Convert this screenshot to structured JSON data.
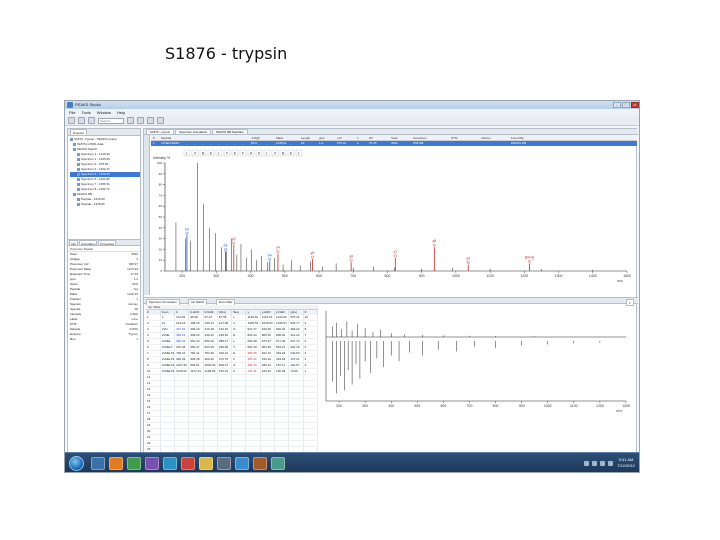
{
  "slide": {
    "title": "S1876 - trypsin"
  },
  "window": {
    "title": "PEAKS Studio",
    "menu": [
      "File",
      "Tools",
      "Window",
      "Help"
    ],
    "search_placeholder": "Search..."
  },
  "project_tree": {
    "items": [
      "S1876 - trypsin - PEAKS project",
      "S1876 mzXML data",
      "PEAKS Search",
      "Spectrum 1 - 1216.93",
      "Spectrum 2 - 1345.66",
      "Spectrum 3 - 978.52",
      "Spectrum 4 - 1102.47",
      "Spectrum 5 - 1376.23",
      "Spectrum 6 - 1421.80",
      "Spectrum 7 - 1056.31",
      "Spectrum 8 - 1190.72",
      "PEAKS DB",
      "Peptide - 1216.93",
      "Peptide - 1345.66"
    ],
    "selected_index": 7
  },
  "properties": {
    "tabs": [
      "Info",
      "Annotation",
      "Properties"
    ],
    "header": "Precursor Details",
    "rows": [
      [
        "Scan",
        "3520"
      ],
      [
        "Charge",
        "2"
      ],
      [
        "Precursor m/z",
        "608.97"
      ],
      [
        "Precursor Mass",
        "1215.93"
      ],
      [
        "Retention Time",
        "37.45"
      ],
      [
        "ppm",
        "1.2"
      ],
      [
        "Score",
        "56.8"
      ],
      [
        "Peptide",
        "Yes"
      ],
      [
        "Mass",
        "1216.93"
      ],
      [
        "Fraction",
        "1"
      ],
      [
        "Species",
        "Human"
      ],
      [
        "Spectra",
        "38"
      ],
      [
        "Intensity",
        "2.5E6"
      ],
      [
        "Label",
        "none"
      ],
      [
        "PTM",
        "Oxidation"
      ],
      [
        "Sample",
        "S1876"
      ],
      [
        "Enzyme",
        "Trypsin"
      ],
      [
        "Run",
        "1"
      ]
    ]
  },
  "doc_tabs": [
    "S1876 - trypsin",
    "Spectrum Annotation",
    "PEAKS DB Peptides"
  ],
  "psm_table": {
    "headers": [
      "#",
      "Peptide",
      "-10lgP",
      "Mass",
      "Length",
      "ppm",
      "m/z",
      "z",
      "RT",
      "Scan",
      "Accession",
      "PTM",
      "AScore",
      "Found By"
    ],
    "row": [
      "1",
      "LVNELTEFAK",
      "56.8",
      "1148.61",
      "10",
      "1.2",
      "575.31",
      "2",
      "37.45",
      "3520",
      "P02768",
      "",
      "",
      "PEAKS DB"
    ]
  },
  "lower_tabs": [
    "Spectrum Annotation",
    "Ion Match",
    "Error Map"
  ],
  "frag_table": {
    "tab": "Ion Table",
    "headers": [
      "#",
      "b-ion",
      "b",
      "b-H2O",
      "b-NH3",
      "b(2+)",
      "Seq",
      "y",
      "y-H2O",
      "y-NH3",
      "y(2+)",
      "#"
    ],
    "rows": [
      [
        "1",
        "L",
        "114.09",
        "96.08",
        "97.07",
        "57.55",
        "L",
        "1149.62",
        "1131.61",
        "1132.60",
        "575.31",
        "10"
      ],
      [
        "2",
        "LV",
        "213.16",
        "195.15",
        "196.13",
        "107.08",
        "V",
        "1036.54",
        "1018.53",
        "1019.51",
        "518.77",
        "9"
      ],
      [
        "3",
        "LVN",
        "327.20",
        "309.19",
        "310.18",
        "164.10",
        "N",
        "937.47",
        "919.46",
        "920.44",
        "469.24",
        "8"
      ],
      [
        "4",
        "LVNE",
        "456.24",
        "438.23",
        "439.22",
        "228.62",
        "E",
        "823.43",
        "805.42",
        "806.40",
        "412.22",
        "7"
      ],
      [
        "5",
        "LVNEL",
        "569.33",
        "551.32",
        "552.30",
        "285.17",
        "L",
        "694.38",
        "676.37",
        "677.36",
        "347.70",
        "6"
      ],
      [
        "6",
        "LVNELT",
        "670.38",
        "652.37",
        "653.35",
        "335.69",
        "T",
        "581.30",
        "563.29",
        "564.27",
        "291.15",
        "5"
      ],
      [
        "7",
        "LVNELTE",
        "799.42",
        "781.41",
        "782.39",
        "400.21",
        "E",
        "480.25",
        "462.24",
        "463.22",
        "240.63",
        "4"
      ],
      [
        "8",
        "LVNELTEF",
        "946.49",
        "928.48",
        "929.46",
        "473.75",
        "F",
        "351.21",
        "333.20",
        "334.18",
        "176.11",
        "3"
      ],
      [
        "9",
        "LVNELTEFA",
        "1017.52",
        "999.51",
        "1000.50",
        "509.27",
        "A",
        "204.13",
        "186.12",
        "187.11",
        "102.57",
        "2"
      ],
      [
        "10",
        "LVNELTEFAK",
        "1145.62",
        "1127.61",
        "1128.59",
        "573.31",
        "K",
        "147.11",
        "129.10",
        "130.09",
        "74.06",
        "1"
      ],
      [
        "11",
        "",
        "",
        "",
        "",
        "",
        "",
        "",
        "",
        "",
        "",
        ""
      ],
      [
        "12",
        "",
        "",
        "",
        "",
        "",
        "",
        "",
        "",
        "",
        "",
        ""
      ],
      [
        "13",
        "",
        "",
        "",
        "",
        "",
        "",
        "",
        "",
        "",
        "",
        ""
      ],
      [
        "14",
        "",
        "",
        "",
        "",
        "",
        "",
        "",
        "",
        "",
        "",
        ""
      ],
      [
        "15",
        "",
        "",
        "",
        "",
        "",
        "",
        "",
        "",
        "",
        "",
        ""
      ],
      [
        "16",
        "",
        "",
        "",
        "",
        "",
        "",
        "",
        "",
        "",
        "",
        ""
      ],
      [
        "17",
        "",
        "",
        "",
        "",
        "",
        "",
        "",
        "",
        "",
        "",
        ""
      ],
      [
        "18",
        "",
        "",
        "",
        "",
        "",
        "",
        "",
        "",
        "",
        "",
        ""
      ],
      [
        "19",
        "",
        "",
        "",
        "",
        "",
        "",
        "",
        "",
        "",
        "",
        ""
      ],
      [
        "20",
        "",
        "",
        "",
        "",
        "",
        "",
        "",
        "",
        "",
        "",
        ""
      ],
      [
        "21",
        "",
        "",
        "",
        "",
        "",
        "",
        "",
        "",
        "",
        "",
        ""
      ],
      [
        "22",
        "",
        "",
        "",
        "",
        "",
        "",
        "",
        "",
        "",
        "",
        ""
      ],
      [
        "23",
        "",
        "",
        "",
        "",
        "",
        "",
        "",
        "",
        "",
        "",
        ""
      ],
      [
        "24",
        "",
        "",
        "",
        "",
        "",
        "",
        "",
        "",
        "",
        "",
        ""
      ],
      [
        "25",
        "",
        "",
        "",
        "",
        "",
        "",
        "",
        "",
        "",
        "",
        ""
      ]
    ],
    "highlight_red_rows": [
      6,
      7,
      8,
      9
    ],
    "highlight_blue_rows": [
      2,
      3,
      4
    ]
  },
  "taskbar": {
    "clock_time": "9:41 AM",
    "clock_date": "7/12/2012",
    "task_icon_colors": [
      "#3d6fa8",
      "#e07b1f",
      "#3f9a4a",
      "#7a4fb0",
      "#2d8fc4",
      "#c9433c",
      "#d9b84a",
      "#5a6b7d",
      "#3b8ccf",
      "#a05a2c",
      "#4a9a8a"
    ]
  },
  "chart_data": [
    {
      "type": "bar",
      "title": "",
      "xlabel": "m/z",
      "ylabel": "Intensity %",
      "xlim": [
        150,
        1500
      ],
      "ylim": [
        0,
        100
      ],
      "x_ticks": [
        200,
        300,
        400,
        500,
        600,
        700,
        800,
        900,
        1000,
        1100,
        1200,
        1300,
        1400,
        1500
      ],
      "y_ticks": [
        0,
        10,
        20,
        30,
        40,
        50,
        60,
        70,
        80,
        90,
        100
      ],
      "sequence_header": [
        "L",
        "V",
        "N",
        "E",
        "L",
        "T",
        "E",
        "F",
        "A",
        "K",
        "L",
        "V",
        "N",
        "E",
        "L"
      ],
      "peaks": [
        {
          "mz": 182,
          "i": 45
        },
        {
          "mz": 210,
          "i": 30
        },
        {
          "mz": 225,
          "i": 28
        },
        {
          "mz": 245,
          "i": 100
        },
        {
          "mz": 262,
          "i": 62
        },
        {
          "mz": 280,
          "i": 40
        },
        {
          "mz": 298,
          "i": 35
        },
        {
          "mz": 315,
          "i": 22
        },
        {
          "mz": 330,
          "i": 18
        },
        {
          "mz": 345,
          "i": 30
        },
        {
          "mz": 360,
          "i": 15
        },
        {
          "mz": 372,
          "i": 25
        },
        {
          "mz": 388,
          "i": 12
        },
        {
          "mz": 402,
          "i": 20
        },
        {
          "mz": 418,
          "i": 10
        },
        {
          "mz": 432,
          "i": 14
        },
        {
          "mz": 450,
          "i": 8
        },
        {
          "mz": 470,
          "i": 12
        },
        {
          "mz": 495,
          "i": 6
        },
        {
          "mz": 520,
          "i": 10
        },
        {
          "mz": 545,
          "i": 5
        },
        {
          "mz": 575,
          "i": 9
        },
        {
          "mz": 610,
          "i": 4
        },
        {
          "mz": 650,
          "i": 7
        },
        {
          "mz": 700,
          "i": 3
        },
        {
          "mz": 760,
          "i": 4
        },
        {
          "mz": 820,
          "i": 3
        },
        {
          "mz": 900,
          "i": 2
        },
        {
          "mz": 990,
          "i": 3
        },
        {
          "mz": 1100,
          "i": 2
        },
        {
          "mz": 1250,
          "i": 2
        },
        {
          "mz": 1400,
          "i": 1
        }
      ],
      "annotated_peaks": [
        {
          "mz": 214,
          "i": 33,
          "label": "b2",
          "color": "#1f4fbf"
        },
        {
          "mz": 327,
          "i": 18,
          "label": "b3",
          "color": "#1f4fbf"
        },
        {
          "mz": 456,
          "i": 9,
          "label": "b4",
          "color": "#1f4fbf"
        },
        {
          "mz": 351,
          "i": 24,
          "label": "y3",
          "color": "#c62828"
        },
        {
          "mz": 480,
          "i": 16,
          "label": "y4",
          "color": "#c62828"
        },
        {
          "mz": 581,
          "i": 11,
          "label": "y5",
          "color": "#c62828"
        },
        {
          "mz": 694,
          "i": 8,
          "label": "y6",
          "color": "#c62828"
        },
        {
          "mz": 823,
          "i": 12,
          "label": "y7",
          "color": "#c62828"
        },
        {
          "mz": 937,
          "i": 22,
          "label": "y8",
          "color": "#c62828"
        },
        {
          "mz": 1036,
          "i": 6,
          "label": "y9",
          "color": "#c62828"
        },
        {
          "mz": 1215,
          "i": 7,
          "label": "[M+H]",
          "color": "#c62828"
        }
      ]
    },
    {
      "type": "bar",
      "title": "",
      "xlabel": "m/z",
      "ylabel": "",
      "xlim": [
        150,
        1300
      ],
      "ylim": [
        -100,
        100
      ],
      "x_ticks": [
        200,
        300,
        400,
        500,
        600,
        700,
        800,
        900,
        1000,
        1100,
        1200,
        1300
      ],
      "top_peaks": [
        {
          "mz": 175,
          "i": 40
        },
        {
          "mz": 190,
          "i": 55
        },
        {
          "mz": 210,
          "i": 30
        },
        {
          "mz": 230,
          "i": 60
        },
        {
          "mz": 250,
          "i": 25
        },
        {
          "mz": 270,
          "i": 50
        },
        {
          "mz": 300,
          "i": 35
        },
        {
          "mz": 330,
          "i": 20
        },
        {
          "mz": 360,
          "i": 28
        },
        {
          "mz": 400,
          "i": 15
        },
        {
          "mz": 450,
          "i": 10
        },
        {
          "mz": 520,
          "i": 8
        },
        {
          "mz": 600,
          "i": 6
        },
        {
          "mz": 700,
          "i": 5
        },
        {
          "mz": 800,
          "i": 4
        },
        {
          "mz": 950,
          "i": 3
        }
      ],
      "bottom_peaks": [
        {
          "mz": 175,
          "i": 70
        },
        {
          "mz": 190,
          "i": 90
        },
        {
          "mz": 205,
          "i": 60
        },
        {
          "mz": 220,
          "i": 85
        },
        {
          "mz": 235,
          "i": 50
        },
        {
          "mz": 250,
          "i": 75
        },
        {
          "mz": 265,
          "i": 40
        },
        {
          "mz": 280,
          "i": 65
        },
        {
          "mz": 300,
          "i": 35
        },
        {
          "mz": 320,
          "i": 55
        },
        {
          "mz": 345,
          "i": 30
        },
        {
          "mz": 370,
          "i": 45
        },
        {
          "mz": 400,
          "i": 25
        },
        {
          "mz": 430,
          "i": 35
        },
        {
          "mz": 470,
          "i": 20
        },
        {
          "mz": 520,
          "i": 25
        },
        {
          "mz": 580,
          "i": 15
        },
        {
          "mz": 650,
          "i": 18
        },
        {
          "mz": 720,
          "i": 10
        },
        {
          "mz": 800,
          "i": 12
        },
        {
          "mz": 900,
          "i": 8
        },
        {
          "mz": 1000,
          "i": 6
        },
        {
          "mz": 1100,
          "i": 4
        },
        {
          "mz": 1200,
          "i": 3
        }
      ]
    }
  ]
}
